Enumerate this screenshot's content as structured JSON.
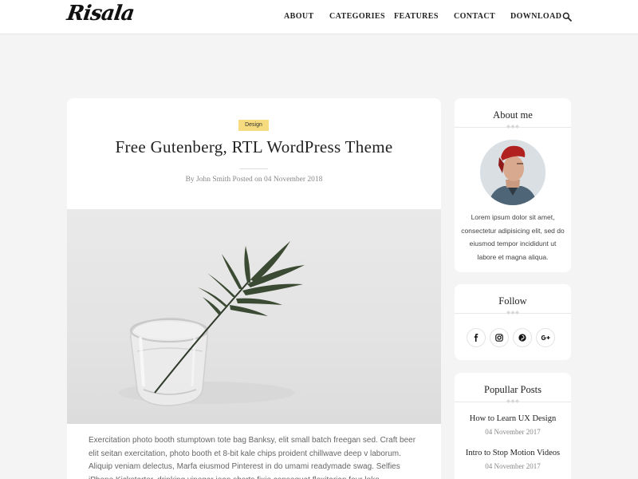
{
  "header": {
    "logo": "Risala",
    "nav": [
      "ABOUT",
      "CATEGORIES",
      "FEATURES",
      "CONTACT",
      "DOWNLOAD"
    ],
    "search_icon": "search-icon"
  },
  "post": {
    "category": "Design",
    "title": "Free Gutenberg, RTL WordPress Theme",
    "meta": "By John Smith Posted on 04 November 2018",
    "excerpt": "Exercitation photo booth stumptown tote bag Banksy, elit small batch freegan sed. Craft beer elit seitan exercitation, photo booth et 8-bit kale chips proident chillwave deep v laborum. Aliquip veniam delectus, Marfa eiusmod Pinterest in do umami readymade swag. Selfies iPhone Kickstarter, drinking vinegar jean shorts fixie consequat flexitarian four loko."
  },
  "sidebar": {
    "about": {
      "title": "About me",
      "text": "Lorem ipsum dolor sit amet, consectetur adipisicing elit, sed do eiusmod tempor incididunt ut labore et magna aliqua."
    },
    "follow": {
      "title": "Follow",
      "icons": [
        "facebook-icon",
        "instagram-icon",
        "pinterest-icon",
        "google-plus-icon"
      ]
    },
    "popular": {
      "title": "Popullar Posts",
      "posts": [
        {
          "title": "How to Learn UX Design",
          "date": "04 November 2017"
        },
        {
          "title": "Intro to Stop Motion Videos",
          "date": "04 November 2017"
        }
      ]
    }
  },
  "colors": {
    "background": "#f4f4f4",
    "badge": "#f6dc7e",
    "card": "#ffffff"
  }
}
